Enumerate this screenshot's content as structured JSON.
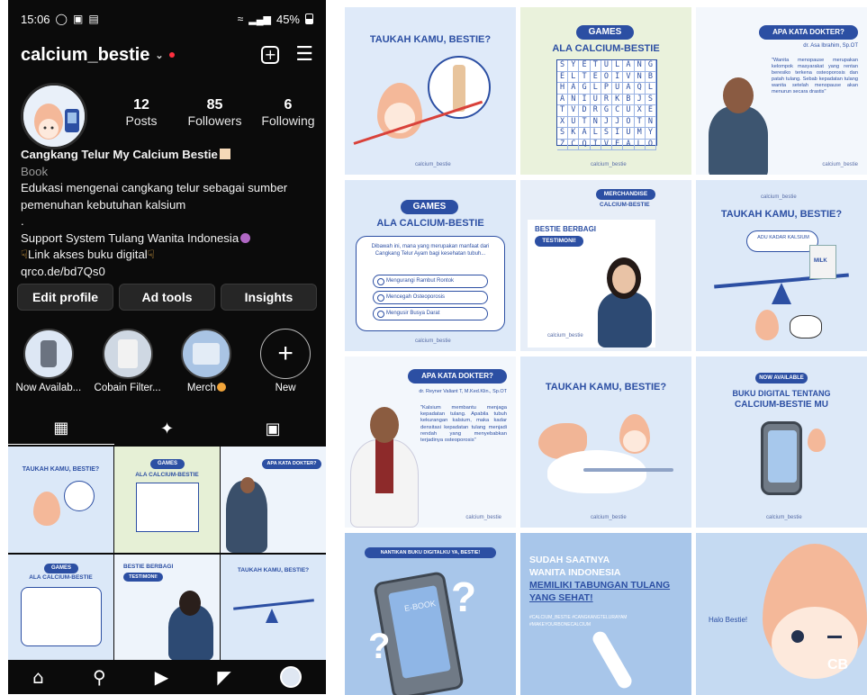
{
  "status": {
    "time": "15:06",
    "battery": "45%"
  },
  "profile": {
    "username": "calcium_bestie",
    "stats": [
      {
        "value": "12",
        "label": "Posts"
      },
      {
        "value": "85",
        "label": "Followers"
      },
      {
        "value": "6",
        "label": "Following"
      }
    ],
    "name": "Cangkang Telur My Calcium Bestie",
    "category": "Book",
    "bio_lines": [
      "Edukasi mengenai cangkang telur sebagai sumber pemenuhan kebutuhan kalsium",
      ".",
      "Support System Tulang Wanita Indonesia",
      "Link akses buku digital",
      "qrco.de/bd7Qs0"
    ],
    "buttons": [
      "Edit profile",
      "Ad tools",
      "Insights"
    ],
    "highlights": [
      "Now Availab...",
      "Cobain Filter...",
      "Merch",
      "New"
    ]
  },
  "posts": {
    "taukah": "TAUKAH KAMU, BESTIE?",
    "games_pill": "GAMES",
    "games_sub": "ALA CALCIUM-BESTIE",
    "word_grid": [
      [
        "S",
        "Y",
        "E",
        "T",
        "U",
        "L",
        "A",
        "N",
        "G"
      ],
      [
        "E",
        "L",
        "T",
        "E",
        "O",
        "I",
        "V",
        "N",
        "B"
      ],
      [
        "H",
        "A",
        "G",
        "L",
        "P",
        "U",
        "A",
        "Q",
        "L"
      ],
      [
        "A",
        "N",
        "I",
        "U",
        "R",
        "K",
        "B",
        "J",
        "S"
      ],
      [
        "T",
        "V",
        "D",
        "R",
        "G",
        "C",
        "U",
        "X",
        "E"
      ],
      [
        "X",
        "U",
        "T",
        "N",
        "J",
        "J",
        "O",
        "T",
        "N"
      ],
      [
        "S",
        "K",
        "A",
        "L",
        "S",
        "I",
        "U",
        "M",
        "Y"
      ],
      [
        "Z",
        "C",
        "Q",
        "I",
        "V",
        "E",
        "A",
        "L",
        "O"
      ]
    ],
    "handle": "calcium_bestie",
    "apa_kata": "APA KATA DOKTER?",
    "doctor1": "dr. Asa Ibrahim, Sp.OT",
    "doctor1_quote": "\"Wanita menopause merupakan kelompok masyarakat yang rentan beresiko terkena osteoporosis dan patah tulang. Sebab kepadatan tulang wanita setelah menopause akan menurun secara drastis\"",
    "games_question": "Dibawah ini, mana yang merupakan manfaat dari Cangkang Telur Ayam bagi kesehatan tubuh...",
    "games_options": [
      "Mengurangi Rambut Rontok",
      "Mencegah Osteoporosis",
      "Mengusir Busya Darat"
    ],
    "merch_title": "MERCHANDISE",
    "merch_sub": "CALCIUM-BESTIE",
    "testimoni_1": "BESTIE BERBAGI",
    "testimoni_2": "TESTIMONI!",
    "adu_kadar": "ADU KADAR KALSIUM",
    "milk": "MILK",
    "doctor2": "dr. Reyner Valiant T, M.Ked.Klin., Sp.OT",
    "doctor2_quote": "\"Kalsium membantu menjaga kepadatan tulang. Apabila tubuh kekurangan kalsium, maka kadar densitasi kepadatan tulang menjadi rendah yang menyebabkan terjadinya osteoporosis\"",
    "now_available": "NOW AVAILABLE",
    "buku_1": "BUKU DIGITAL TENTANG",
    "buku_2": "CALCIUM-BESTIE MU",
    "nantikan": "NANTIKAN BUKU DIGITALKU YA, BESTIE!",
    "ebook": "E-BOOK",
    "sudah_1": "SUDAH SAATNYA",
    "sudah_2": "WANITA INDONESIA",
    "sudah_3": "MEMILIKI TABUNGAN TULANG",
    "sudah_4": "YANG SEHAT!",
    "hashtags": "#CALCIUM_BESTIE #CANGKANGTELURAYAM #MAKEYOURBONECALCIUM",
    "halo": "Halo Bestie!",
    "cb": "CB"
  },
  "colors": {
    "accent": "#2c4fa3",
    "tile_bg": "#dbe8f8",
    "phone_bg": "#0b0b0b",
    "egg": "#f4b899"
  }
}
